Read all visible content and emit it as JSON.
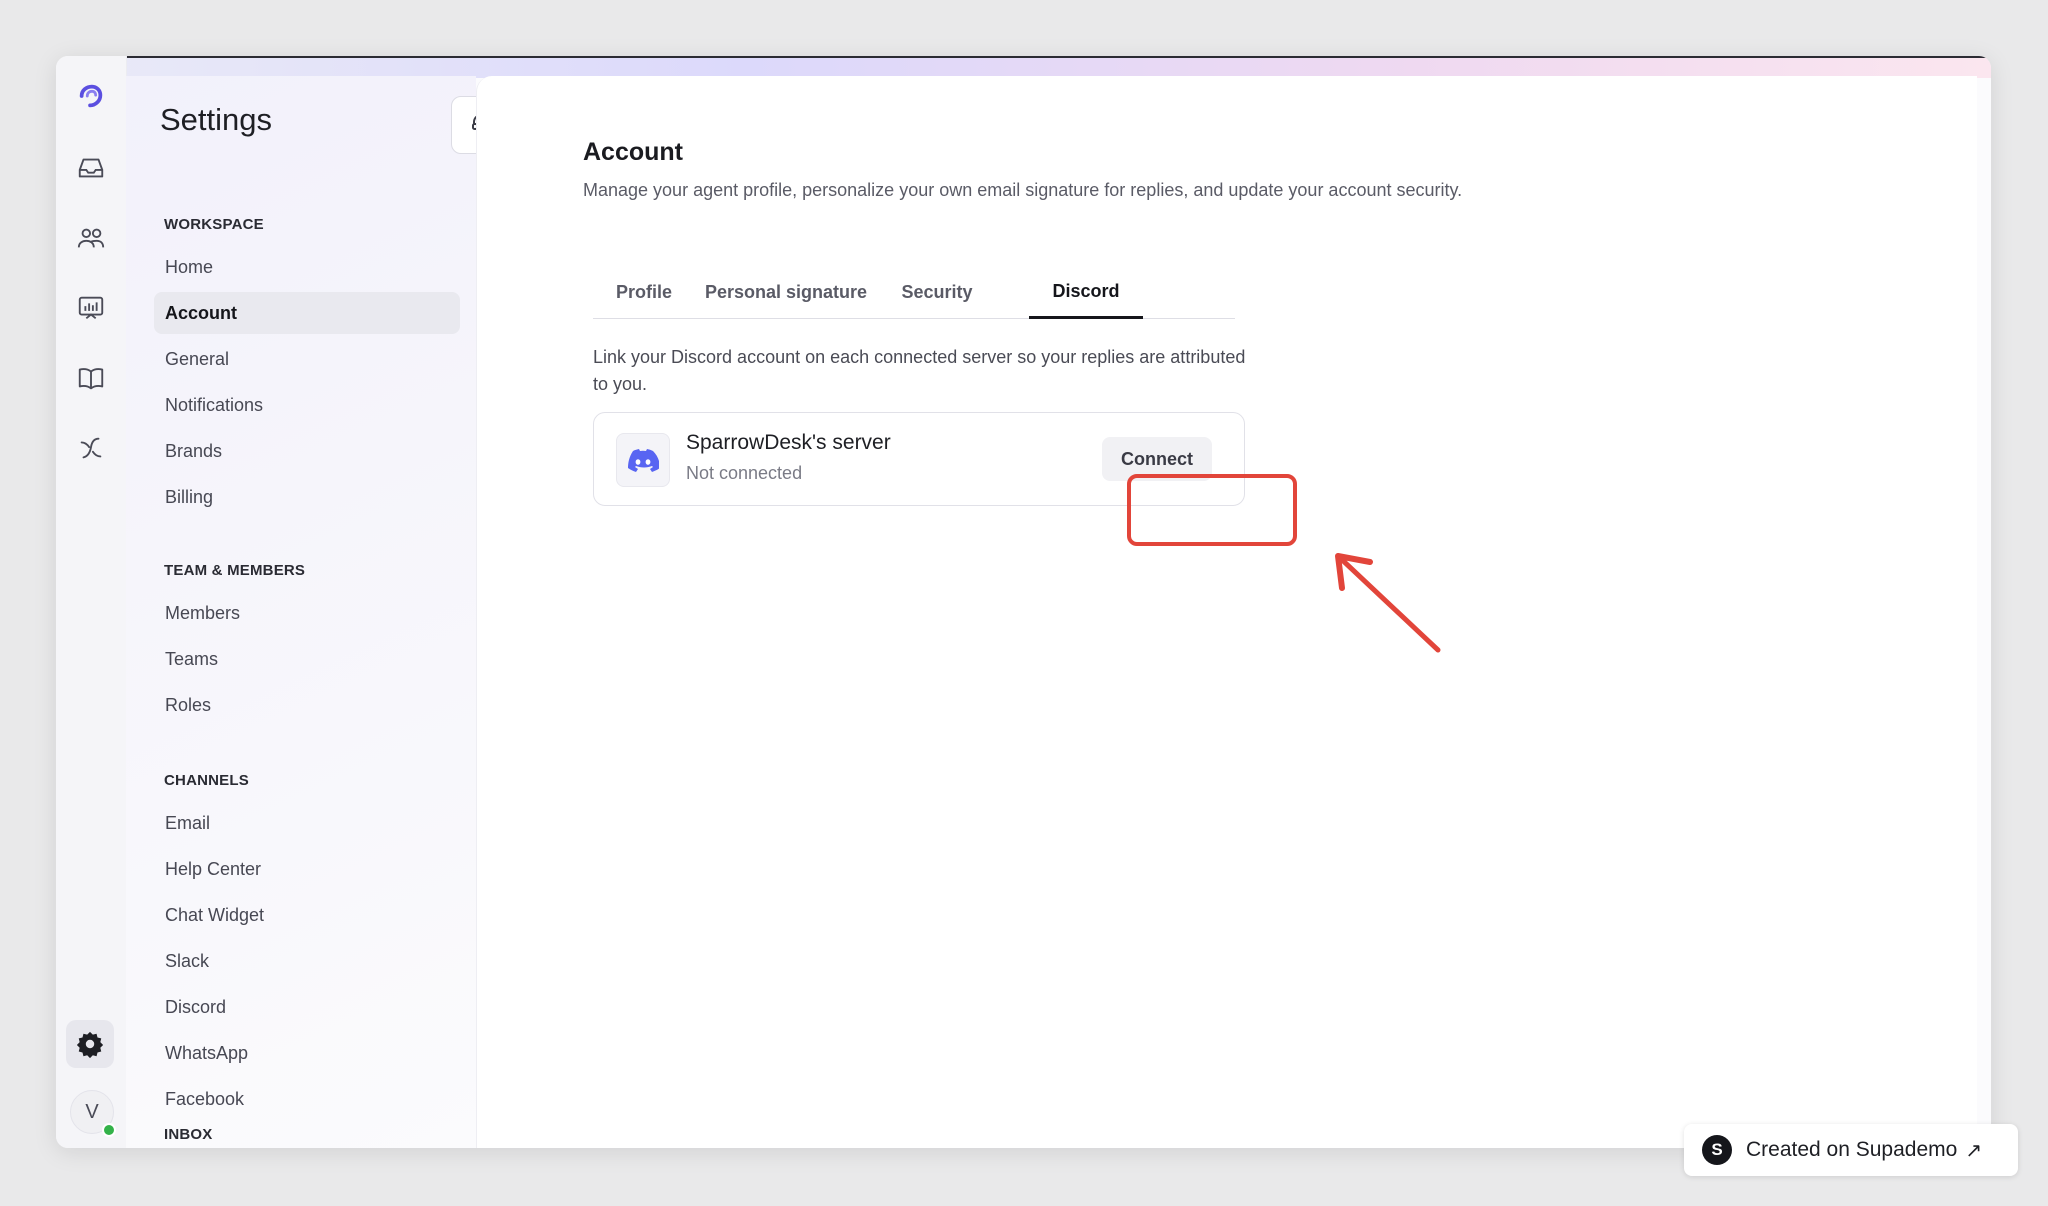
{
  "sidebar": {
    "title": "Settings",
    "sections": [
      {
        "label": "WORKSPACE",
        "items": [
          {
            "label": "Home",
            "active": false
          },
          {
            "label": "Account",
            "active": true
          },
          {
            "label": "General",
            "active": false
          },
          {
            "label": "Notifications",
            "active": false
          },
          {
            "label": "Brands",
            "active": false
          },
          {
            "label": "Billing",
            "active": false
          }
        ]
      },
      {
        "label": "TEAM & MEMBERS",
        "items": [
          {
            "label": "Members"
          },
          {
            "label": "Teams"
          },
          {
            "label": "Roles"
          }
        ]
      },
      {
        "label": "CHANNELS",
        "items": [
          {
            "label": "Email"
          },
          {
            "label": "Help Center"
          },
          {
            "label": "Chat Widget"
          },
          {
            "label": "Slack"
          },
          {
            "label": "Discord"
          },
          {
            "label": "WhatsApp"
          },
          {
            "label": "Facebook"
          }
        ]
      },
      {
        "label": "INBOX",
        "items": []
      }
    ]
  },
  "rail": {
    "avatar_initial": "V",
    "icons": [
      "logo-icon",
      "inbox-icon",
      "contacts-icon",
      "reports-icon",
      "knowledge-base-icon",
      "ai-agent-icon",
      "gear-icon"
    ]
  },
  "main": {
    "title": "Account",
    "description": "Manage your agent profile, personalize your own email signature for replies, and update your account security.",
    "tabs": [
      {
        "label": "Profile",
        "active": false
      },
      {
        "label": "Personal signature",
        "active": false
      },
      {
        "label": "Security",
        "active": false
      },
      {
        "label": "Discord",
        "active": true
      }
    ],
    "discord_note": "Link your Discord account on each connected server so your replies are attributed to you.",
    "server": {
      "name": "SparrowDesk's server",
      "status": "Not connected",
      "button_label": "Connect"
    }
  },
  "badge": {
    "logo_letter": "S",
    "text": "Created on Supademo"
  },
  "colors": {
    "accent": "#5b4fe0",
    "discord": "#5865f2",
    "annotation": "#e2453a",
    "online": "#33b249"
  }
}
